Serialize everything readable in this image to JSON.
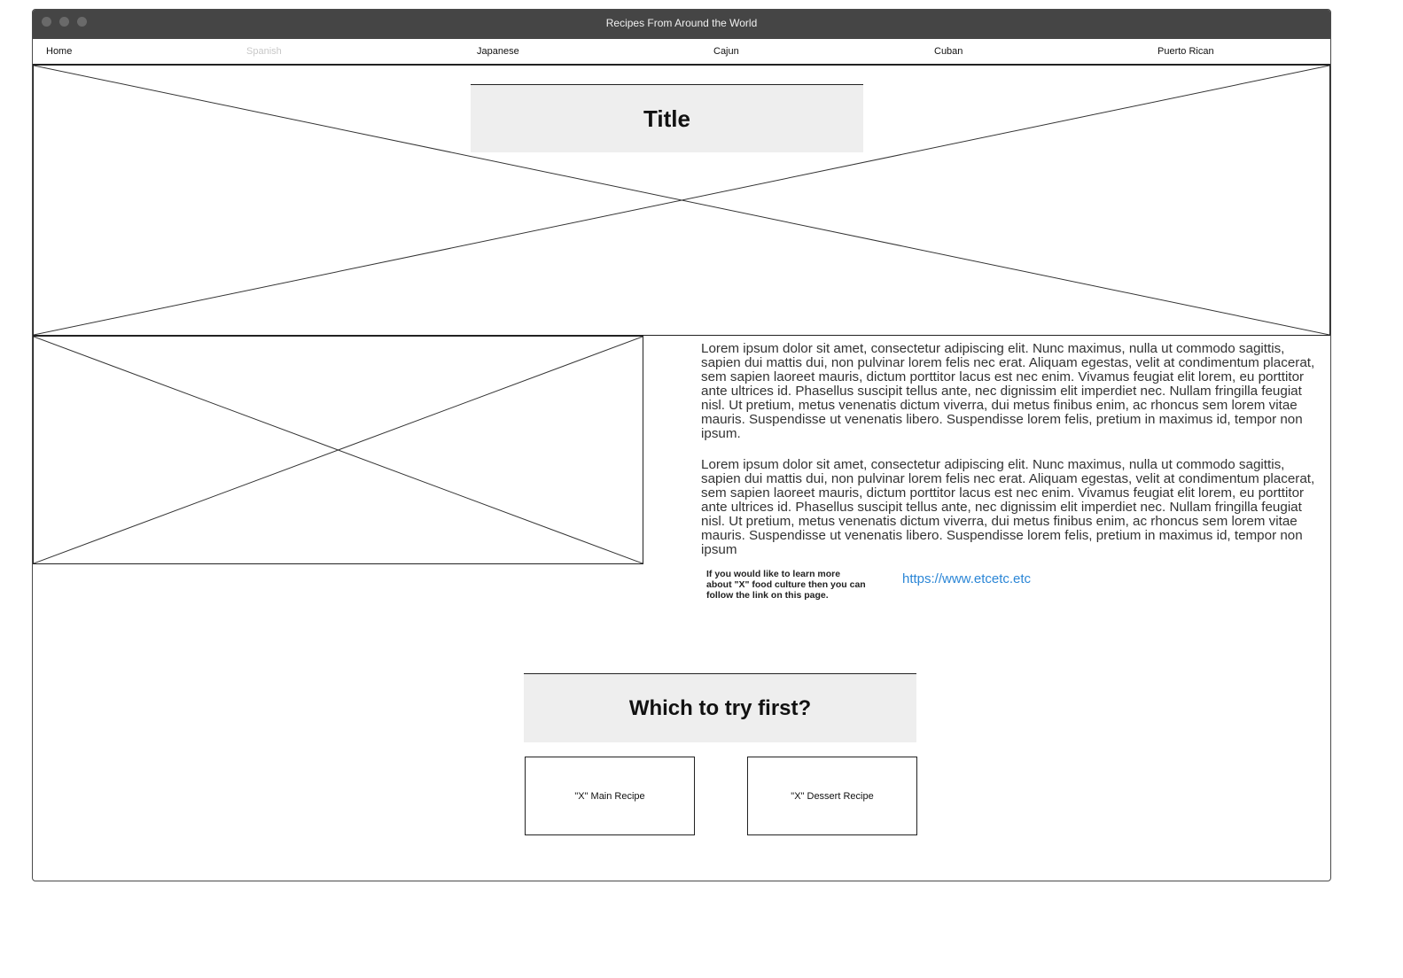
{
  "window": {
    "title": "Recipes From Around the World"
  },
  "nav": {
    "items": [
      {
        "label": "Home",
        "state": "active"
      },
      {
        "label": "Spanish",
        "state": "disabled"
      },
      {
        "label": "Japanese",
        "state": "active"
      },
      {
        "label": "Cajun",
        "state": "active"
      },
      {
        "label": "Cuban",
        "state": "active"
      },
      {
        "label": "Puerto Rican",
        "state": "active"
      }
    ]
  },
  "hero": {
    "title": "Title"
  },
  "content": {
    "paragraphs": [
      "Lorem ipsum dolor sit amet, consectetur adipiscing elit. Nunc maximus, nulla ut commodo sagittis, sapien dui mattis dui, non pulvinar lorem felis nec erat. Aliquam egestas, velit at condimentum placerat, sem sapien laoreet mauris, dictum porttitor lacus est nec enim. Vivamus feugiat elit lorem, eu porttitor ante ultrices id. Phasellus suscipit tellus ante, nec dignissim elit imperdiet nec. Nullam fringilla feugiat nisl. Ut pretium, metus venenatis dictum viverra, dui metus finibus enim, ac rhoncus sem lorem vitae mauris. Suspendisse ut venenatis libero. Suspendisse lorem felis, pretium in maximus id, tempor non ipsum.",
      "Lorem ipsum dolor sit amet, consectetur adipiscing elit. Nunc maximus, nulla ut commodo sagittis, sapien dui mattis dui, non pulvinar lorem felis nec erat. Aliquam egestas, velit at condimentum placerat, sem sapien laoreet mauris, dictum porttitor lacus est nec enim. Vivamus feugiat elit lorem, eu porttitor ante ultrices id. Phasellus suscipit tellus ante, nec dignissim elit imperdiet nec. Nullam fringilla feugiat nisl. Ut pretium, metus venenatis dictum viverra, dui metus finibus enim, ac rhoncus sem lorem vitae mauris. Suspendisse ut venenatis libero. Suspendisse lorem felis, pretium in maximus id, tempor non ipsum"
    ],
    "info_note": "If you would like to learn more about \"X\" food culture then you can follow the link on this page.",
    "link_text": "https://www.etcetc.etc"
  },
  "choice": {
    "title": "Which to try first?",
    "buttons": {
      "main": "\"X\" Main Recipe",
      "dessert": "\"X\" Dessert Recipe"
    }
  },
  "colors": {
    "titlebar": "#454545",
    "link": "#2b86d6",
    "title_box": "#eeeeee",
    "disabled_nav": "#c8c8c8"
  },
  "icons": {
    "window_controls": [
      "close-dot-icon",
      "minimize-dot-icon",
      "maximize-dot-icon"
    ],
    "image_placeholder": "image-placeholder-icon"
  }
}
